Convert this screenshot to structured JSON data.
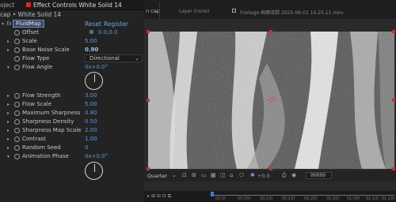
{
  "left_panel": {
    "project_tab": "oject",
    "effect_controls_tab": "Effect Controls White Solid 14",
    "layer_title": "cap • White Solid 14",
    "effect_name": "FluidMap",
    "reset_label": "Reset",
    "register_label": "Register",
    "fx_label": "fx"
  },
  "properties": [
    {
      "label": "Offset",
      "value": "0.0,0.0"
    },
    {
      "label": "Scale",
      "value": "5.00"
    },
    {
      "label": "Base Noise Scale",
      "value": "0.90"
    },
    {
      "label": "Flow Type",
      "value": "Directional"
    },
    {
      "label": "Flow Angle",
      "value": "0x+0.0°"
    },
    {
      "label": "Flow Strength",
      "value": "3.00"
    },
    {
      "label": "Flow Scale",
      "value": "5.00"
    },
    {
      "label": "Maximum Sharpness",
      "value": "0.80"
    },
    {
      "label": "Sharpness Density",
      "value": "0.50"
    },
    {
      "label": "Sharpness Map Scale",
      "value": "2.00"
    },
    {
      "label": "Contrast",
      "value": "1.00"
    },
    {
      "label": "Random Seed",
      "value": "0"
    },
    {
      "label": "Animation Phase",
      "value": "0x+0.0°"
    }
  ],
  "right_panel": {
    "comp_tab": "n cap",
    "layer_label": "Layer (none)",
    "footage_label": "Footage 画面収録 2025-06-01 14.25.11.mov",
    "zoom_select": "Quarter",
    "exposure_value": "+0.0",
    "frame_value": "00000",
    "timeline_ticks": [
      "00:0f",
      "00:05f",
      "00:10f",
      "00:15f",
      "00:20f",
      "01:00f",
      "01:05f",
      "01:10f",
      "01:15f"
    ]
  }
}
